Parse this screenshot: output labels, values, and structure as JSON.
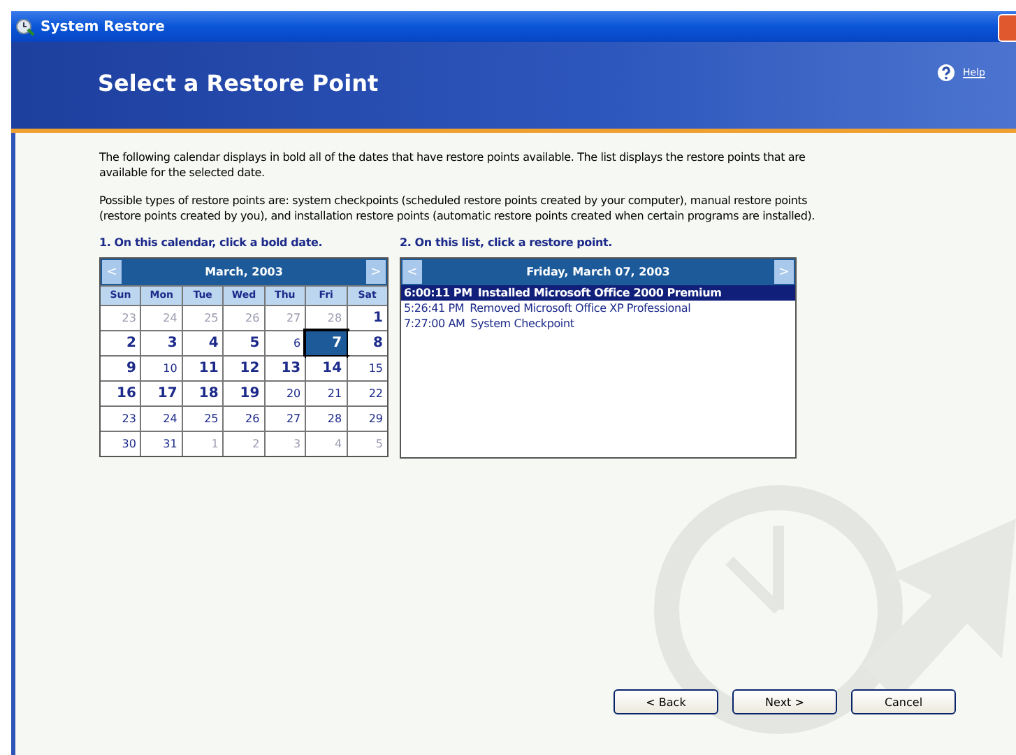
{
  "window": {
    "title": "System Restore"
  },
  "header": {
    "title": "Select a Restore Point",
    "help": "Help"
  },
  "intro": [
    "The following calendar displays in bold all of the dates that have restore points available. The list displays the restore points that are available for the selected date.",
    "Possible types of restore points are: system checkpoints (scheduled restore points created by your computer), manual restore points (restore points created by you), and installation restore points (automatic restore points created when certain programs are installed)."
  ],
  "calendar": {
    "caption": "1. On this calendar, click a bold date.",
    "prev": "<",
    "next": ">",
    "month": "March, 2003",
    "weekdays": [
      "Sun",
      "Mon",
      "Tue",
      "Wed",
      "Thu",
      "Fri",
      "Sat"
    ],
    "days": [
      {
        "text": "23",
        "bold": false,
        "other_month": true,
        "selected": false
      },
      {
        "text": "24",
        "bold": false,
        "other_month": true,
        "selected": false
      },
      {
        "text": "25",
        "bold": false,
        "other_month": true,
        "selected": false
      },
      {
        "text": "26",
        "bold": false,
        "other_month": true,
        "selected": false
      },
      {
        "text": "27",
        "bold": false,
        "other_month": true,
        "selected": false
      },
      {
        "text": "28",
        "bold": false,
        "other_month": true,
        "selected": false
      },
      {
        "text": "1",
        "bold": true,
        "other_month": false,
        "selected": false
      },
      {
        "text": "2",
        "bold": true,
        "other_month": false,
        "selected": false
      },
      {
        "text": "3",
        "bold": true,
        "other_month": false,
        "selected": false
      },
      {
        "text": "4",
        "bold": true,
        "other_month": false,
        "selected": false
      },
      {
        "text": "5",
        "bold": true,
        "other_month": false,
        "selected": false
      },
      {
        "text": "6",
        "bold": false,
        "other_month": false,
        "selected": false
      },
      {
        "text": "7",
        "bold": true,
        "other_month": false,
        "selected": true
      },
      {
        "text": "8",
        "bold": true,
        "other_month": false,
        "selected": false
      },
      {
        "text": "9",
        "bold": true,
        "other_month": false,
        "selected": false
      },
      {
        "text": "10",
        "bold": false,
        "other_month": false,
        "selected": false
      },
      {
        "text": "11",
        "bold": true,
        "other_month": false,
        "selected": false
      },
      {
        "text": "12",
        "bold": true,
        "other_month": false,
        "selected": false
      },
      {
        "text": "13",
        "bold": true,
        "other_month": false,
        "selected": false
      },
      {
        "text": "14",
        "bold": true,
        "other_month": false,
        "selected": false
      },
      {
        "text": "15",
        "bold": false,
        "other_month": false,
        "selected": false
      },
      {
        "text": "16",
        "bold": true,
        "other_month": false,
        "selected": false
      },
      {
        "text": "17",
        "bold": true,
        "other_month": false,
        "selected": false
      },
      {
        "text": "18",
        "bold": true,
        "other_month": false,
        "selected": false
      },
      {
        "text": "19",
        "bold": true,
        "other_month": false,
        "selected": false
      },
      {
        "text": "20",
        "bold": false,
        "other_month": false,
        "selected": false
      },
      {
        "text": "21",
        "bold": false,
        "other_month": false,
        "selected": false
      },
      {
        "text": "22",
        "bold": false,
        "other_month": false,
        "selected": false
      },
      {
        "text": "23",
        "bold": false,
        "other_month": false,
        "selected": false
      },
      {
        "text": "24",
        "bold": false,
        "other_month": false,
        "selected": false
      },
      {
        "text": "25",
        "bold": false,
        "other_month": false,
        "selected": false
      },
      {
        "text": "26",
        "bold": false,
        "other_month": false,
        "selected": false
      },
      {
        "text": "27",
        "bold": false,
        "other_month": false,
        "selected": false
      },
      {
        "text": "28",
        "bold": false,
        "other_month": false,
        "selected": false
      },
      {
        "text": "29",
        "bold": false,
        "other_month": false,
        "selected": false
      },
      {
        "text": "30",
        "bold": false,
        "other_month": false,
        "selected": false
      },
      {
        "text": "31",
        "bold": false,
        "other_month": false,
        "selected": false
      },
      {
        "text": "1",
        "bold": false,
        "other_month": true,
        "selected": false
      },
      {
        "text": "2",
        "bold": false,
        "other_month": true,
        "selected": false
      },
      {
        "text": "3",
        "bold": false,
        "other_month": true,
        "selected": false
      },
      {
        "text": "4",
        "bold": false,
        "other_month": true,
        "selected": false
      },
      {
        "text": "5",
        "bold": false,
        "other_month": true,
        "selected": false
      }
    ]
  },
  "restore_list": {
    "caption": "2. On this list, click a restore point.",
    "prev": "<",
    "next": ">",
    "date": "Friday, March 07, 2003",
    "items": [
      {
        "time": "6:00:11 PM",
        "description": "Installed Microsoft Office 2000 Premium",
        "selected": true
      },
      {
        "time": "5:26:41 PM",
        "description": "Removed Microsoft Office XP Professional",
        "selected": false
      },
      {
        "time": "7:27:00 AM",
        "description": "System Checkpoint",
        "selected": false
      }
    ]
  },
  "buttons": [
    "< Back",
    "Next >",
    "Cancel"
  ]
}
